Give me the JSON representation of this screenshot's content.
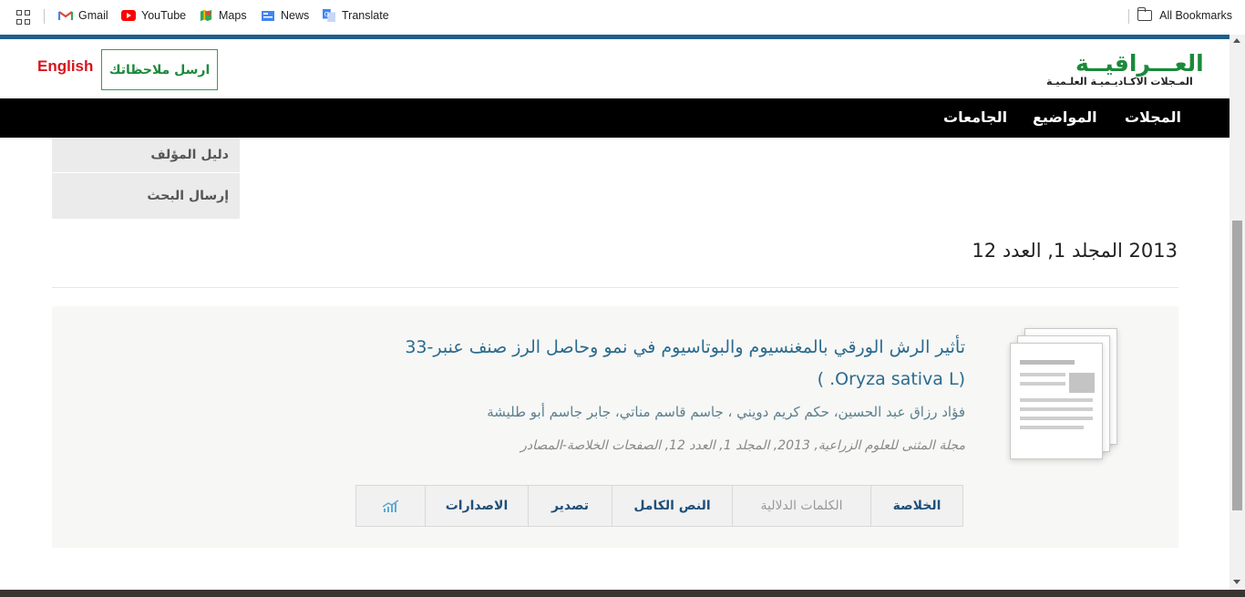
{
  "bookmarks": {
    "items": [
      {
        "label": "Gmail",
        "icon": "gmail-icon"
      },
      {
        "label": "YouTube",
        "icon": "youtube-icon"
      },
      {
        "label": "Maps",
        "icon": "maps-icon"
      },
      {
        "label": "News",
        "icon": "news-icon"
      },
      {
        "label": "Translate",
        "icon": "translate-icon"
      }
    ],
    "all_bookmarks": "All Bookmarks"
  },
  "header": {
    "logo_title": "العـــراقيــة",
    "logo_subtitle": "المـجلات الاكـاديـميـة العلـميـة",
    "feedback_button": "ارسل ملاحظاتك",
    "language_link": "English",
    "logo_color": "#1a8a3a"
  },
  "nav": {
    "items": [
      "المجلات",
      "المواضيع",
      "الجامعات"
    ]
  },
  "sidebar": {
    "items": [
      "دليل المؤلف",
      "إرسال البحث"
    ]
  },
  "issue": {
    "title": "2013 المجلد 1, العدد 12"
  },
  "article": {
    "title": "تأثير الرش الورقي بالمغنسيوم والبوتاسيوم في نمو وحاصل الرز صنف عنبر-33 (Oryza sativa L. )",
    "authors": "فؤاد رزاق عبد الحسين، حكم كريم دويني ، جاسم قاسم مناتي، جابر جاسم أبو طليشة",
    "citation": "مجلة المثنى للعلوم الزراعية, 2013, المجلد 1, العدد 12, الصفحات الخلاصة-المصادر",
    "tabs": [
      {
        "label": "الخلاصة",
        "muted": false
      },
      {
        "label": "الكلمات الدلالية",
        "muted": true
      },
      {
        "label": "النص الكامل",
        "muted": false
      },
      {
        "label": "تصدير",
        "muted": false
      },
      {
        "label": "الاصدارات",
        "muted": false
      },
      {
        "label": "",
        "icon": "stats-chart-icon"
      }
    ]
  },
  "colors": {
    "brand_blue": "#1f5f8b",
    "link": "#2a6b8f",
    "english": "#d8141b"
  }
}
